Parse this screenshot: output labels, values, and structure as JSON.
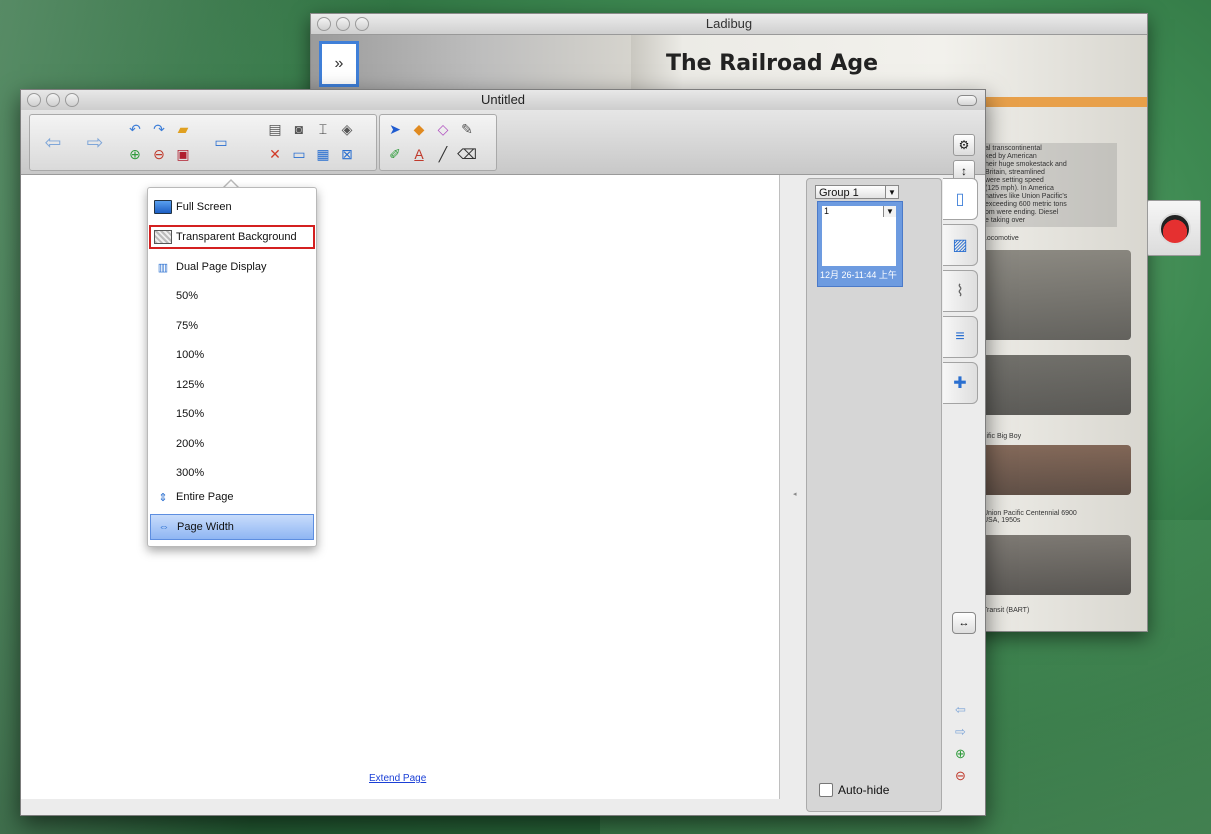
{
  "ladibug": {
    "title": "Ladibug",
    "expand_glyph": "»",
    "book_title": "The Railroad Age",
    "book_text": "al transcontinental\nked by American\nheir huge smokestack and\nBritain, streamlined\nwere setting speed\n(125 mph). In America\nnatives like Union Pacific's\nexceeding 600 metric tons\nom were ending. Diesel\ne taking over",
    "caption_locomotive": "Locomotive",
    "caption_bigboy": "cific Big Boy",
    "caption_centennial": "Union Pacific Centennial 6900\nUSA, 1950s",
    "caption_bart": "Transit (BART)"
  },
  "untitled": {
    "title": "Untitled",
    "extend_link": "Extend Page"
  },
  "thumbnails": {
    "group_label": "Group 1",
    "page_number": "1",
    "timestamp": "12月 26-11:44 上午",
    "autohide_label": "Auto-hide"
  },
  "menu": {
    "items": [
      {
        "label": "Full Screen",
        "icon": "monitor-icon"
      },
      {
        "label": "Transparent Background",
        "icon": "transparent-icon"
      },
      {
        "label": "Dual Page Display",
        "icon": "dual-page-icon"
      },
      {
        "label": "50%"
      },
      {
        "label": "75%"
      },
      {
        "label": "100%"
      },
      {
        "label": "125%"
      },
      {
        "label": "150%"
      },
      {
        "label": "200%"
      },
      {
        "label": "300%"
      },
      {
        "label": "Entire Page",
        "icon": "entire-page-icon"
      },
      {
        "label": "Page Width",
        "icon": "page-width-icon"
      }
    ],
    "highlighted_item": "Transparent Background",
    "selected_item": "Page Width"
  },
  "colors": {
    "highlight_outline": "#d42020",
    "selection": "#8fb6f3",
    "link": "#1a3fd6"
  }
}
